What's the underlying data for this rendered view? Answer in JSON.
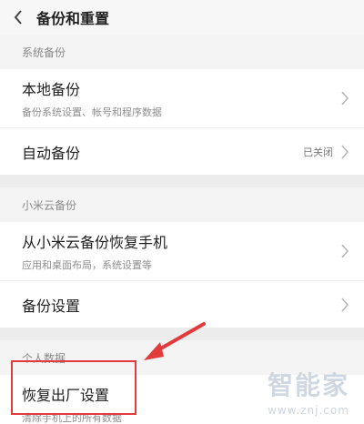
{
  "header": {
    "title": "备份和重置",
    "back_icon": "chevron-left-icon"
  },
  "sections": {
    "system": {
      "label": "系统备份",
      "local_backup": {
        "title": "本地备份",
        "subtitle": "备份系统设置、帐号和程序数据"
      },
      "auto_backup": {
        "title": "自动备份",
        "value": "已关闭"
      }
    },
    "cloud": {
      "label": "小米云备份",
      "restore": {
        "title": "从小米云备份恢复手机",
        "subtitle": "应用和桌面布局，系统设置等"
      },
      "settings": {
        "title": "备份设置"
      }
    },
    "personal": {
      "label": "个人数据",
      "factory_reset": {
        "title": "恢复出厂设置",
        "subtitle": "清除手机上的所有数据"
      }
    }
  },
  "watermark": {
    "text": "智能家",
    "url": "www.znj.com"
  },
  "colors": {
    "highlight": "#e23b3b",
    "background": "#f2f2f2"
  }
}
